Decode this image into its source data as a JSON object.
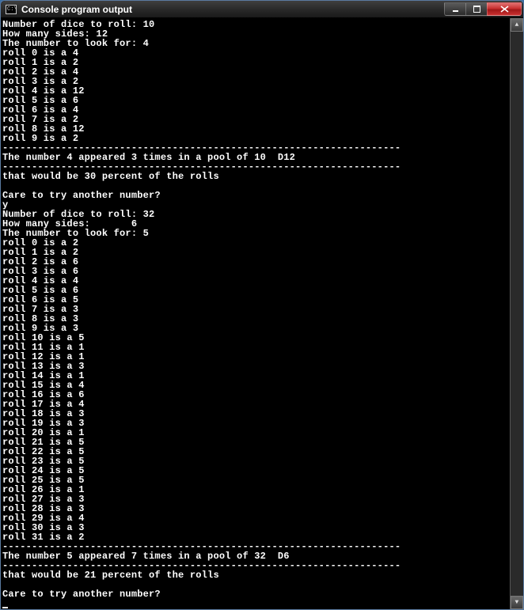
{
  "window": {
    "icon_text": "C:\\",
    "title": "Console program output"
  },
  "run1": {
    "prompt_dice": "Number of dice to roll: ",
    "dice": "10",
    "prompt_sides": "How many sides: ",
    "sides": "12",
    "prompt_look": "The number to look for: ",
    "look": "4",
    "rolls": [
      "roll 0 is a 4",
      "roll 1 is a 2",
      "roll 2 is a 4",
      "roll 3 is a 2",
      "roll 4 is a 12",
      "roll 5 is a 6",
      "roll 6 is a 4",
      "roll 7 is a 2",
      "roll 8 is a 12",
      "roll 9 is a 2"
    ],
    "sep": "--------------------------------------------------------------------",
    "result": "The number 4 appeared 3 times in a pool of 10  D12",
    "percent": "that would be 30 percent of the rolls",
    "again": "Care to try another number?",
    "answer": "y"
  },
  "run2": {
    "prompt_dice": "Number of dice to roll: ",
    "dice": "32",
    "prompt_sides": "How many sides:       ",
    "sides": "6",
    "prompt_look": "The number to look for: ",
    "look": "5",
    "rolls": [
      "roll 0 is a 2",
      "roll 1 is a 2",
      "roll 2 is a 6",
      "roll 3 is a 6",
      "roll 4 is a 4",
      "roll 5 is a 6",
      "roll 6 is a 5",
      "roll 7 is a 3",
      "roll 8 is a 3",
      "roll 9 is a 3",
      "roll 10 is a 5",
      "roll 11 is a 1",
      "roll 12 is a 1",
      "roll 13 is a 3",
      "roll 14 is a 1",
      "roll 15 is a 4",
      "roll 16 is a 6",
      "roll 17 is a 4",
      "roll 18 is a 3",
      "roll 19 is a 3",
      "roll 20 is a 1",
      "roll 21 is a 5",
      "roll 22 is a 5",
      "roll 23 is a 5",
      "roll 24 is a 5",
      "roll 25 is a 5",
      "roll 26 is a 1",
      "roll 27 is a 3",
      "roll 28 is a 3",
      "roll 29 is a 4",
      "roll 30 is a 3",
      "roll 31 is a 2"
    ],
    "sep": "--------------------------------------------------------------------",
    "result": "The number 5 appeared 7 times in a pool of 32  D6",
    "percent": "that would be 21 percent of the rolls",
    "again": "Care to try another number?"
  }
}
